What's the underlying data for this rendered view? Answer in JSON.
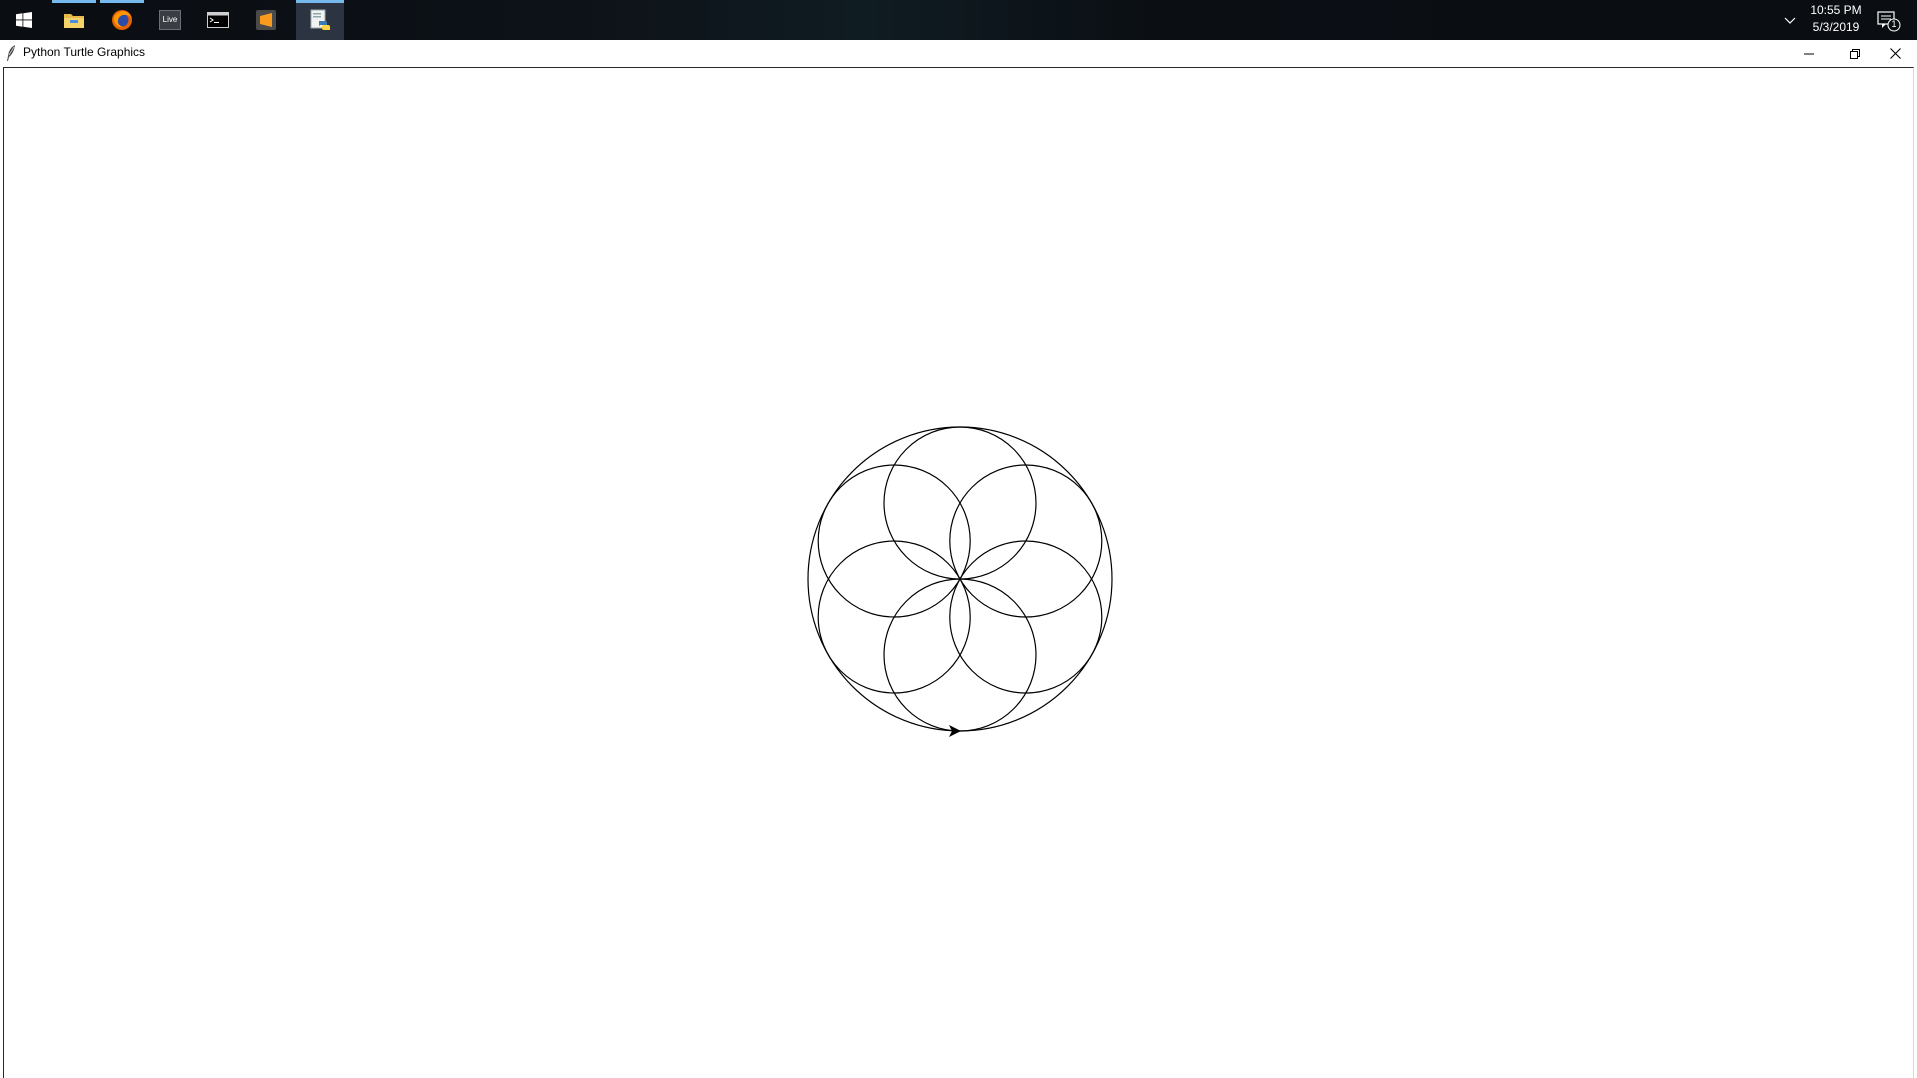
{
  "taskbar": {
    "start_icon": "windows-logo-icon",
    "pinned": [
      {
        "name": "file-explorer-icon",
        "running": true,
        "active": false
      },
      {
        "name": "firefox-icon",
        "running": true,
        "active": false
      },
      {
        "name": "ableton-live-icon",
        "running": false,
        "active": false,
        "label": "Live"
      },
      {
        "name": "command-prompt-icon",
        "running": false,
        "active": false
      },
      {
        "name": "sublime-text-icon",
        "running": false,
        "active": false
      },
      {
        "name": "python-turtle-icon",
        "running": true,
        "active": true
      }
    ],
    "tray_chevron_icon": "chevron-up-icon",
    "clock": {
      "time": "10:55 PM",
      "date": "5/3/2019"
    },
    "notification": {
      "icon": "action-center-icon",
      "count": "1"
    }
  },
  "window": {
    "title": "Python Turtle Graphics",
    "icon": "feather-icon",
    "controls": [
      "minimize-icon",
      "restore-icon",
      "close-icon"
    ]
  },
  "drawing": {
    "description_free": true,
    "stroke_color": "#000000",
    "petal_circle_count": 6,
    "turtle_icon": "turtle-arrow-icon"
  }
}
